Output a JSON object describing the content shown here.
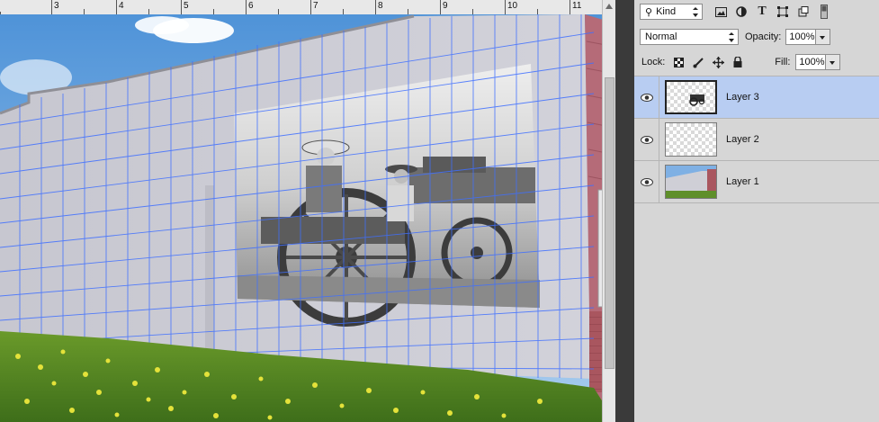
{
  "ruler": {
    "numbers": [
      "3",
      "4",
      "5",
      "6",
      "7",
      "8",
      "9",
      "10",
      "11"
    ]
  },
  "filter": {
    "kind_label": "Kind"
  },
  "blend": {
    "mode": "Normal",
    "opacity_label": "Opacity:",
    "opacity_value": "100%"
  },
  "lock": {
    "label": "Lock:",
    "fill_label": "Fill:",
    "fill_value": "100%"
  },
  "layers": [
    {
      "name": "Layer 3",
      "selected": true
    },
    {
      "name": "Layer 2",
      "selected": false
    },
    {
      "name": "Layer 1",
      "selected": false
    }
  ],
  "colors": {
    "selection": "#b8cdf2",
    "panel_bg": "#d6d6d6",
    "grid": "#3f6fff"
  }
}
